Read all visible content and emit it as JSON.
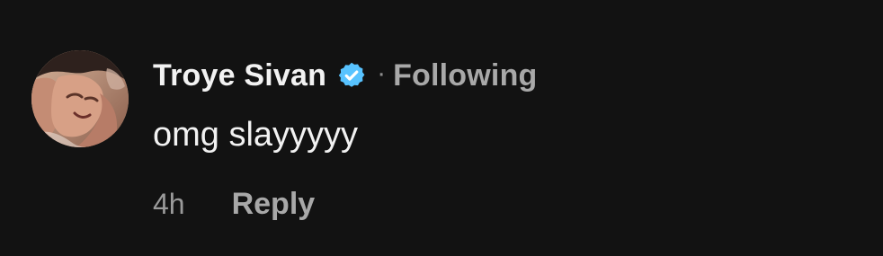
{
  "comment": {
    "username": "Troye Sivan",
    "verified_icon": "verified-badge-icon",
    "separator": "·",
    "follow_status": "Following",
    "text": "omg slayyyyy",
    "timestamp": "4h",
    "reply_label": "Reply",
    "colors": {
      "background": "#121212",
      "primary_text": "#f2f2f2",
      "secondary_text": "#a8a8a8",
      "verified_badge": "#58c3ff"
    }
  }
}
